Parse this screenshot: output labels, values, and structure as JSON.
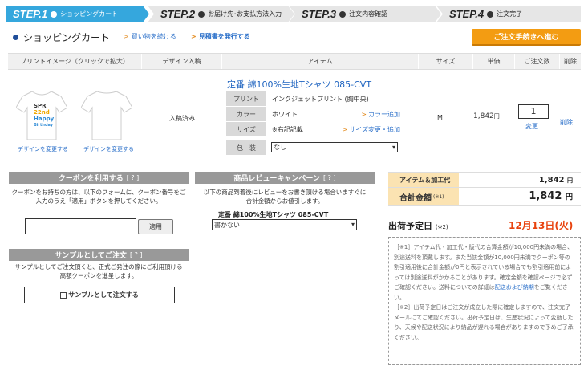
{
  "steps": [
    {
      "num": "STEP.1",
      "label": "ショッピングカート"
    },
    {
      "num": "STEP.2",
      "label": "お届け先･お支払方法入力"
    },
    {
      "num": "STEP.3",
      "label": "注文内容確認"
    },
    {
      "num": "STEP.4",
      "label": "注文完了"
    }
  ],
  "header": {
    "title": "ショッピングカート",
    "continue_link": "買い物を続ける",
    "estimate_link": "見積書を発行する",
    "checkout_button": "ご注文手続きへ進む"
  },
  "table_headers": {
    "print_image": "プリントイメージ（クリックで拡大）",
    "design_submit": "デザイン入稿",
    "item": "アイテム",
    "size": "サイズ",
    "unit_price": "単価",
    "quantity": "ご注文数",
    "delete": "削除"
  },
  "item": {
    "design_change_front": "デザインを変更する",
    "design_change_back": "デザインを変更する",
    "submission_status": "入稿済み",
    "title": "定番 綿100%生地Tシャツ 085-CVT",
    "print_label": "プリント",
    "print_value": "インクジェットプリント (胸中央)",
    "color_label": "カラー",
    "color_value": "ホワイト",
    "color_add": "カラー追加",
    "size_label": "サイズ",
    "size_value": "※右記記載",
    "size_change": "サイズ変更・追加",
    "pack_label": "包　装",
    "pack_value": "なし",
    "size": "M",
    "unit_price": "1,842",
    "unit_price_suffix": "円",
    "quantity": "1",
    "quantity_change": "変更",
    "delete": "削除",
    "shirt_print_lines": [
      "SPR",
      "22nd",
      "Happy",
      "Birthday"
    ]
  },
  "coupon": {
    "title": "クーポンを利用する",
    "help": "[ ? ]",
    "description": "クーポンをお持ちの方は、以下のフォームに、クーポン番号をご入力のうえ「適用」ボタンを押してください。",
    "apply_button": "適用"
  },
  "sample": {
    "title": "サンプルとしてご注文",
    "help": "[ ? ]",
    "description": "サンプルとしてご注文頂くと、正式ご発注の際にご利用頂ける高額クーポンを進呈します。",
    "button": "サンプルとして注文する"
  },
  "review": {
    "title": "商品レビューキャンペーン",
    "help": "[ ? ]",
    "description": "以下の商品到着後にレビューをお書き頂ける場合いますぐに合計金額からお値引します。",
    "item_name": "定番 綿100%生地Tシャツ 085-CVT",
    "select_value": "書かない"
  },
  "summary": {
    "item_label": "アイテム＆加工代",
    "item_value": "1,842",
    "item_suffix": "円",
    "total_label": "合計金額",
    "total_note": "(※1)",
    "total_value": "1,842",
    "total_suffix": "円",
    "ship_label": "出荷予定日",
    "ship_note": "(※2)",
    "ship_date": "12月13日(火)"
  },
  "notes": {
    "n1": "［※1］アイテム代・加工代・版代の合算金額が10,000円未満の場合、別途送料を頂戴します。また当該金額が10,000円未満でクーポン等の割引適用後に合計金額が0円と表示されている場合でも割引適用前によっては別途送料がかかることがあります。確定金額を確認ページで必ずご確認ください。送料についての詳細は",
    "n1_link": "配送および納期",
    "n1_tail": "をご覧ください。",
    "n2": "［※2］出荷予定日はご注文が成立した際に確定しますので、注文完了メールにてご確認ください。出荷予定日は、生産状況によって変動したり、天候や配送状況により納品が遅れる場合がありますので予めご了承ください。"
  },
  "colors": {
    "accent_blue": "#35a7dd",
    "orange": "#f39c12",
    "link": "#2a6fc9",
    "date_red": "#e8420d",
    "summary_label_bg": "#fbe3b2"
  }
}
